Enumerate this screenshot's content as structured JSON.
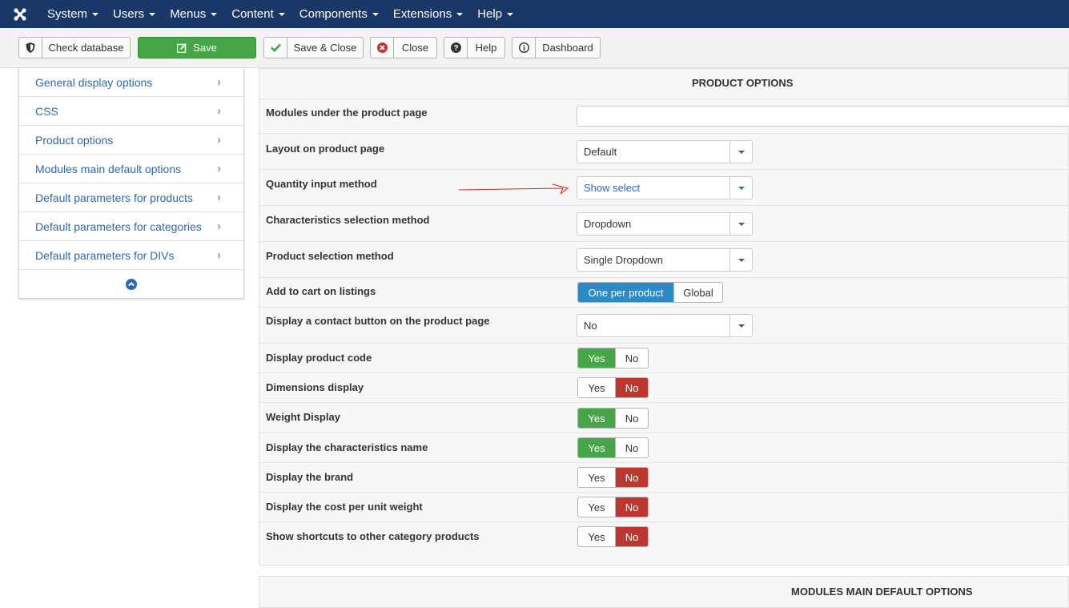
{
  "nav": {
    "items": [
      {
        "label": "System"
      },
      {
        "label": "Users"
      },
      {
        "label": "Menus"
      },
      {
        "label": "Content"
      },
      {
        "label": "Components"
      },
      {
        "label": "Extensions"
      },
      {
        "label": "Help"
      }
    ]
  },
  "toolbar": {
    "check_database": "Check database",
    "save": "Save",
    "save_close": "Save & Close",
    "close": "Close",
    "help": "Help",
    "dashboard": "Dashboard"
  },
  "sidebar": {
    "items": [
      {
        "label": "General display options"
      },
      {
        "label": "CSS"
      },
      {
        "label": "Product options"
      },
      {
        "label": "Modules main default options"
      },
      {
        "label": "Default parameters for products"
      },
      {
        "label": "Default parameters for categories"
      },
      {
        "label": "Default parameters for DIVs"
      }
    ]
  },
  "product_options": {
    "title": "PRODUCT OPTIONS",
    "modules_under": {
      "label": "Modules under the product page",
      "value": ""
    },
    "layout": {
      "label": "Layout on product page",
      "value": "Default"
    },
    "quantity": {
      "label": "Quantity input method",
      "value": "Show select"
    },
    "characteristics": {
      "label": "Characteristics selection method",
      "value": "Dropdown"
    },
    "product_selection": {
      "label": "Product selection method",
      "value": "Single Dropdown"
    },
    "add_to_cart": {
      "label": "Add to cart on listings",
      "opt1": "One per product",
      "opt2": "Global"
    },
    "contact_button": {
      "label": "Display a contact button on the product page",
      "value": "No"
    },
    "product_code": {
      "label": "Display product code",
      "yes": "Yes",
      "no": "No"
    },
    "dimensions": {
      "label": "Dimensions display",
      "yes": "Yes",
      "no": "No"
    },
    "weight": {
      "label": "Weight Display",
      "yes": "Yes",
      "no": "No"
    },
    "char_name": {
      "label": "Display the characteristics name",
      "yes": "Yes",
      "no": "No"
    },
    "brand": {
      "label": "Display the brand",
      "yes": "Yes",
      "no": "No"
    },
    "cost_per_unit": {
      "label": "Display the cost per unit weight",
      "yes": "Yes",
      "no": "No"
    },
    "shortcuts": {
      "label": "Show shortcuts to other category products",
      "yes": "Yes",
      "no": "No"
    }
  },
  "modules_main": {
    "title": "MODULES MAIN DEFAULT OPTIONS"
  },
  "colors": {
    "navbar": "#1a3867",
    "save": "#46a546",
    "yes_active": "#46a546",
    "no_active": "#bd362f",
    "blue_active": "#2d8ac7",
    "link": "#2a69b8"
  }
}
